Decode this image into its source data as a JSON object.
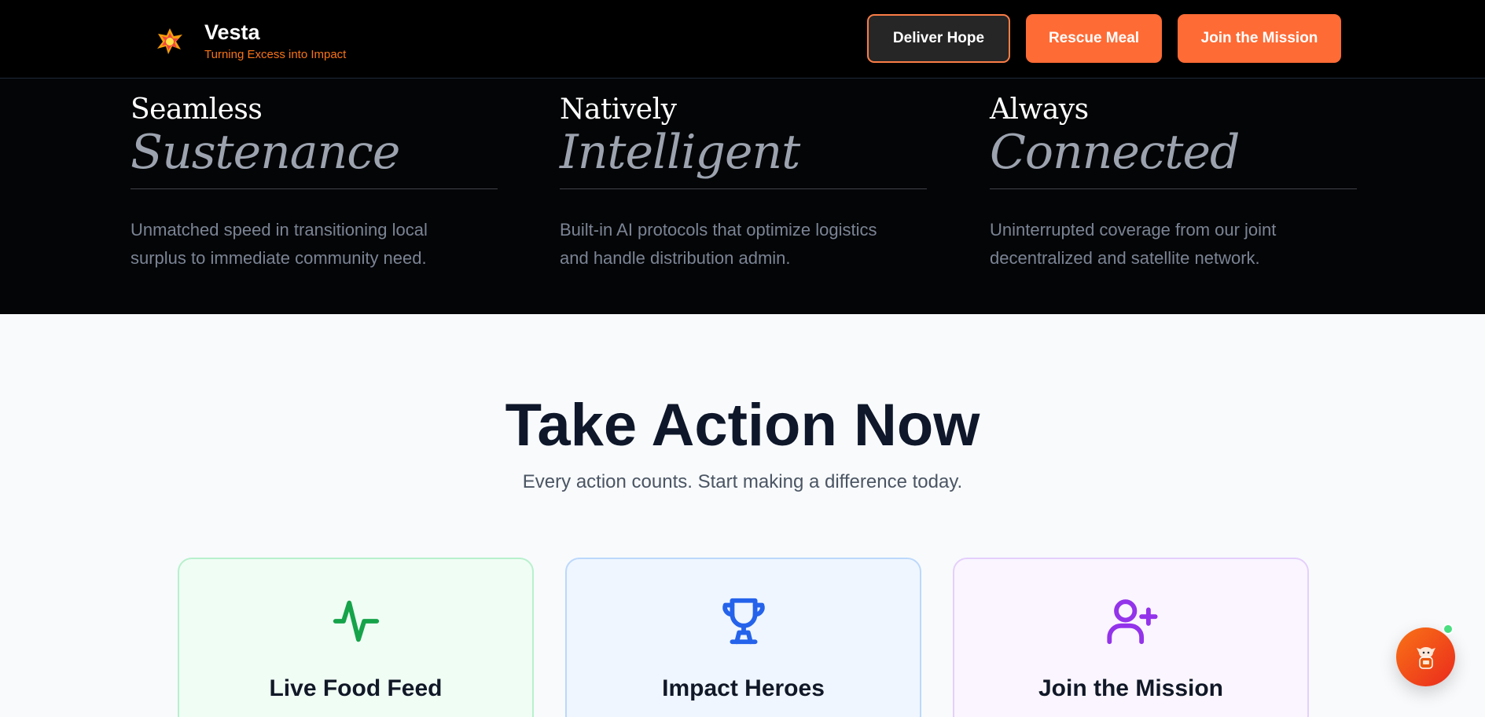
{
  "header": {
    "brand_name": "Vesta",
    "brand_tagline": "Turning Excess into Impact",
    "nav": [
      {
        "label": "Deliver Hope"
      },
      {
        "label": "Rescue Meal"
      },
      {
        "label": "Join the Mission"
      }
    ]
  },
  "features": [
    {
      "word": "Seamless",
      "italic": "Sustenance",
      "description": "Unmatched speed in transitioning local surplus to immediate community need."
    },
    {
      "word": "Natively",
      "italic": "Intelligent",
      "description": "Built-in AI protocols that optimize logistics and handle distribution admin."
    },
    {
      "word": "Always",
      "italic": "Connected",
      "description": "Uninterrupted coverage from our joint decentralized and satellite network."
    }
  ],
  "action": {
    "title": "Take Action Now",
    "subtitle": "Every action counts. Start making a difference today.",
    "cards": [
      {
        "title": "Live Food Feed",
        "icon": "activity-icon"
      },
      {
        "title": "Impact Heroes",
        "icon": "trophy-icon"
      },
      {
        "title": "Join the Mission",
        "icon": "user-plus-icon"
      }
    ]
  },
  "colors": {
    "accent": "#ff6b35",
    "header_bg": "#000000",
    "green": "#16a34a",
    "blue": "#2563eb",
    "purple": "#9333ea"
  }
}
